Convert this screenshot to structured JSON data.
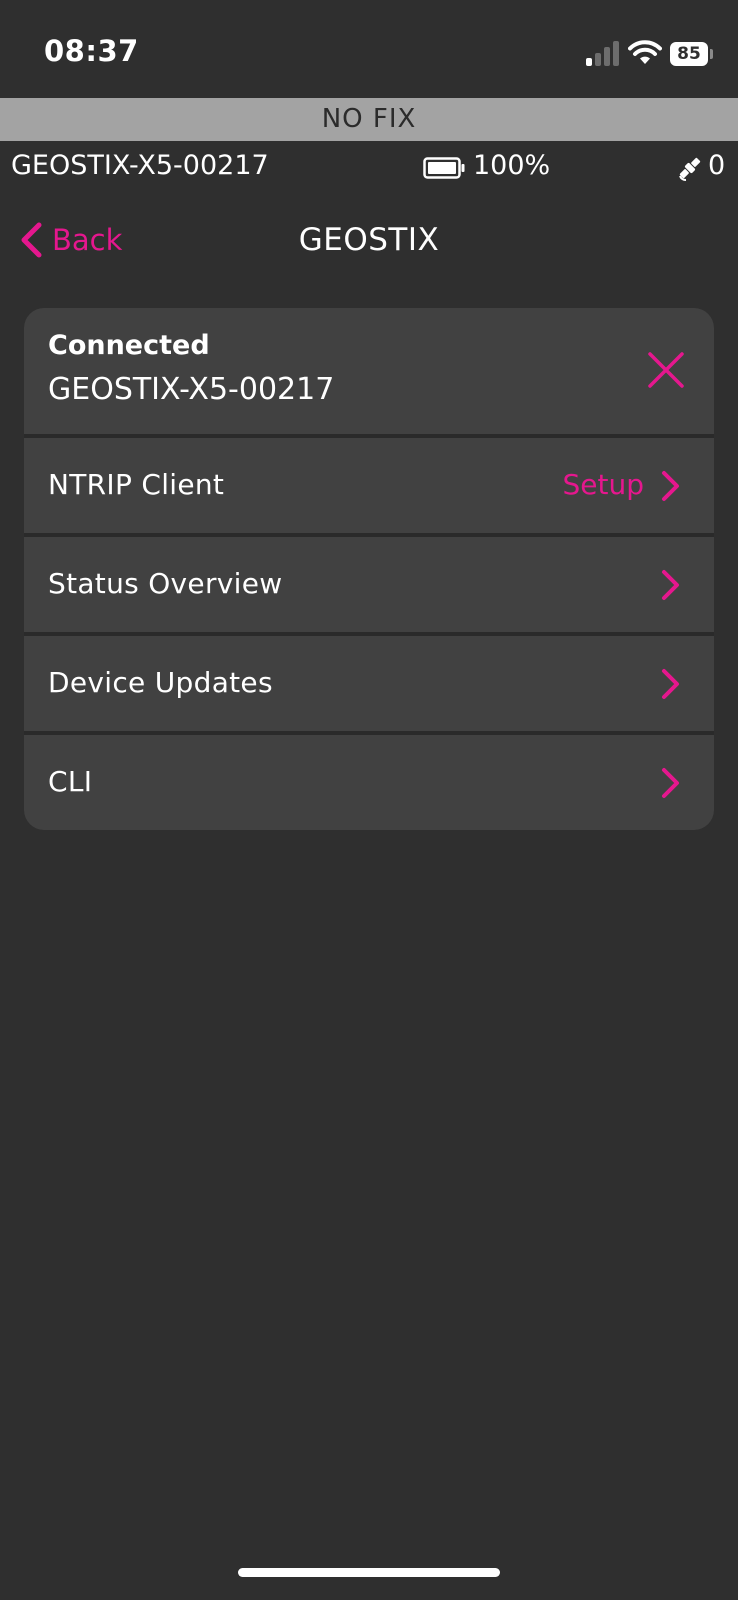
{
  "status_bar": {
    "time": "08:37",
    "battery_level": "85",
    "signal_bars_active": 1,
    "signal_bars_total": 4
  },
  "fix_banner": {
    "text": "NO FIX"
  },
  "device_bar": {
    "device_name": "GEOSTIX-X5-00217",
    "battery_percent": "100%",
    "satellite_count": "0"
  },
  "navbar": {
    "back_label": "Back",
    "title": "GEOSTIX"
  },
  "connection": {
    "status": "Connected",
    "device": "GEOSTIX-X5-00217"
  },
  "menu": {
    "items": [
      {
        "label": "NTRIP Client",
        "detail": "Setup"
      },
      {
        "label": "Status Overview"
      },
      {
        "label": "Device Updates"
      },
      {
        "label": "CLI"
      }
    ]
  },
  "colors": {
    "accent": "#e5178e",
    "background": "#2f2f2f",
    "row_background": "#414141",
    "banner_background": "#a3a3a3"
  },
  "icons": {
    "signal": "cellular-signal-icon",
    "wifi": "wifi-icon",
    "battery": "battery-icon",
    "satellite": "satellite-icon",
    "back": "chevron-left-icon",
    "disconnect": "close-icon",
    "row": "chevron-right-icon"
  }
}
